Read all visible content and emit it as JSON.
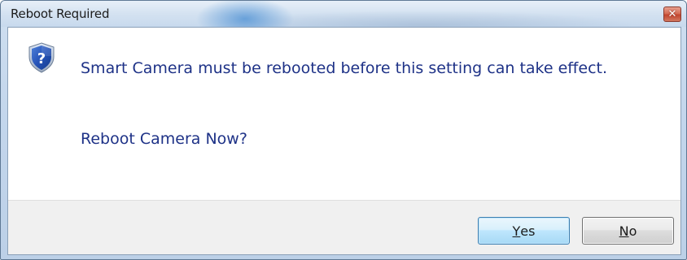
{
  "window": {
    "title": "Reboot Required",
    "close_symbol": "✕"
  },
  "dialog": {
    "icon": "shield-question-icon",
    "message": "Smart Camera must be rebooted before this setting can take effect.",
    "question": "Reboot Camera Now?"
  },
  "buttons": {
    "yes": {
      "mnemonic": "Y",
      "rest": "es"
    },
    "no": {
      "mnemonic": "N",
      "rest": "o"
    }
  },
  "colors": {
    "text_accent": "#1e3287",
    "default_button_border": "#3c7fb1"
  }
}
